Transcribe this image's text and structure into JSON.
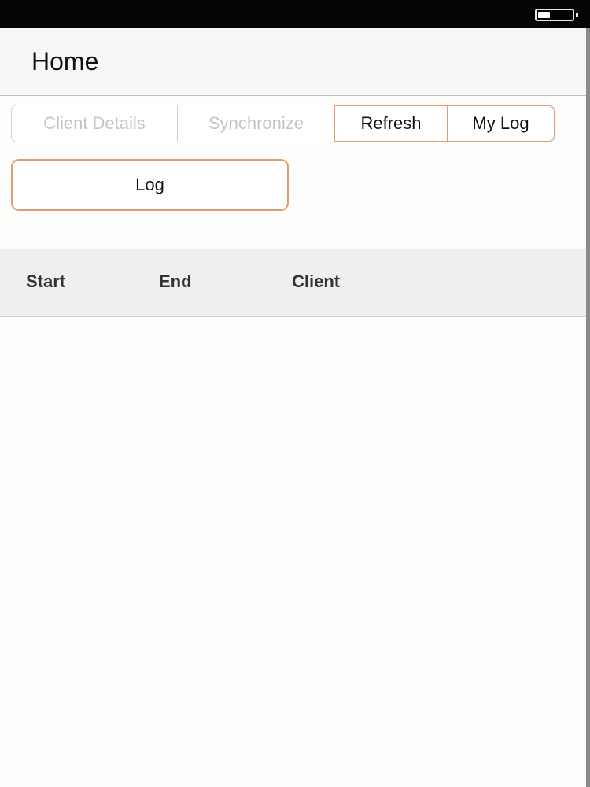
{
  "status_bar": {
    "battery_icon": "battery-icon",
    "battery_level": 0.35
  },
  "nav": {
    "title": "Home"
  },
  "segments": {
    "client_details": "Client Details",
    "synchronize": "Synchronize",
    "refresh": "Refresh",
    "my_log": "My Log"
  },
  "log_button": {
    "label": "Log"
  },
  "table": {
    "columns": [
      "Start",
      "End",
      "Client"
    ],
    "rows": []
  },
  "colors": {
    "accent": "#e69a6c",
    "disabled_text": "#c4c4c4",
    "header_bg": "#efefef"
  }
}
